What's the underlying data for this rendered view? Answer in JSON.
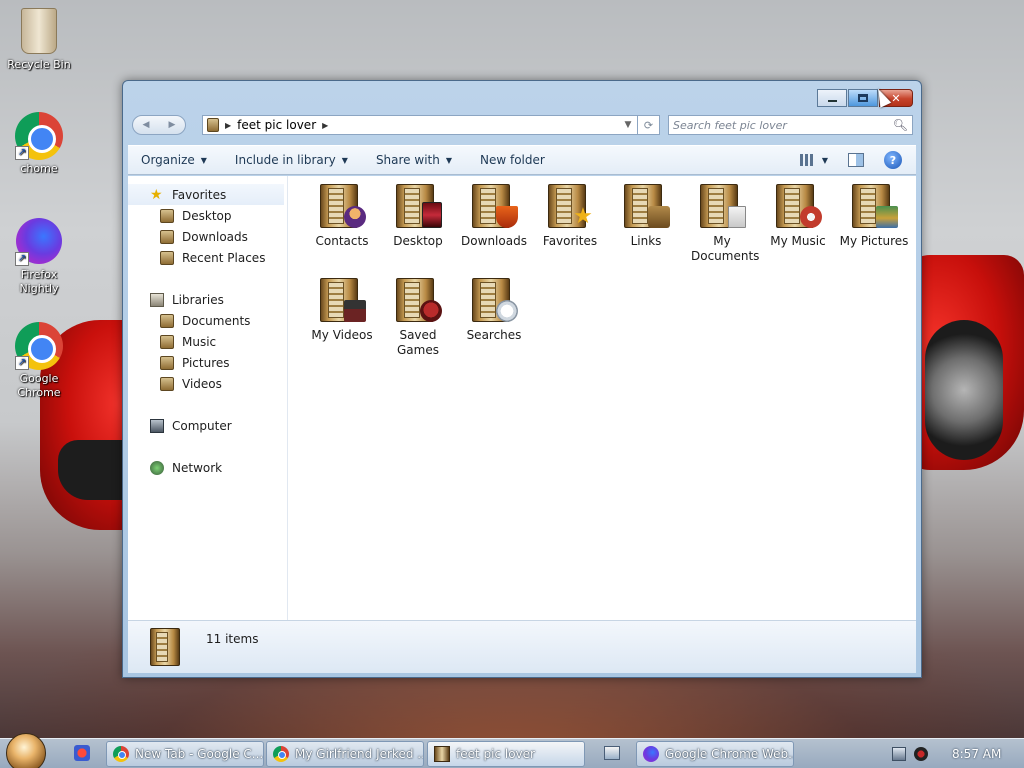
{
  "desktop": {
    "icons": [
      {
        "label": "Recycle Bin",
        "icon": "recycle-bin-icon"
      },
      {
        "label": "chome",
        "icon": "chrome-icon"
      },
      {
        "label": "Firefox Nightly",
        "icon": "firefox-icon"
      },
      {
        "label": "Google Chrome",
        "icon": "chrome-icon"
      }
    ]
  },
  "window": {
    "address": {
      "crumb": "feet pic lover"
    },
    "search": {
      "placeholder": "Search feet pic lover"
    },
    "toolbar": {
      "organize": "Organize",
      "include_in_library": "Include in library",
      "share_with": "Share with",
      "new_folder": "New folder",
      "help": "?"
    },
    "nav": {
      "favorites": "Favorites",
      "desktop": "Desktop",
      "downloads": "Downloads",
      "recent_places": "Recent Places",
      "libraries": "Libraries",
      "documents": "Documents",
      "music": "Music",
      "pictures": "Pictures",
      "videos": "Videos",
      "computer": "Computer",
      "network": "Network"
    },
    "items": [
      {
        "label": "Contacts",
        "badge": "contacts"
      },
      {
        "label": "Desktop",
        "badge": "desktop"
      },
      {
        "label": "Downloads",
        "badge": "downloads"
      },
      {
        "label": "Favorites",
        "badge": "favorites"
      },
      {
        "label": "Links",
        "badge": "links"
      },
      {
        "label": "My Documents",
        "badge": "docs"
      },
      {
        "label": "My Music",
        "badge": "music"
      },
      {
        "label": "My Pictures",
        "badge": "pictures"
      },
      {
        "label": "My Videos",
        "badge": "videos"
      },
      {
        "label": "Saved Games",
        "badge": "games"
      },
      {
        "label": "Searches",
        "badge": "searches"
      }
    ],
    "status": {
      "item_count": "11 items"
    }
  },
  "taskbar": {
    "buttons": [
      {
        "label": "New Tab - Google C...",
        "icon": "chrome-icon"
      },
      {
        "label": "My Girlfriend Jerked ...",
        "icon": "chrome-icon"
      },
      {
        "label": "feet pic lover",
        "icon": "folder-icon"
      },
      {
        "label": "Google Chrome Web...",
        "icon": "firefox-icon"
      }
    ],
    "clock": "8:57 AM"
  },
  "colors": {
    "accent": "#4d97dd",
    "close_red": "#c6432b",
    "window_frame": "#a9c6e2"
  }
}
